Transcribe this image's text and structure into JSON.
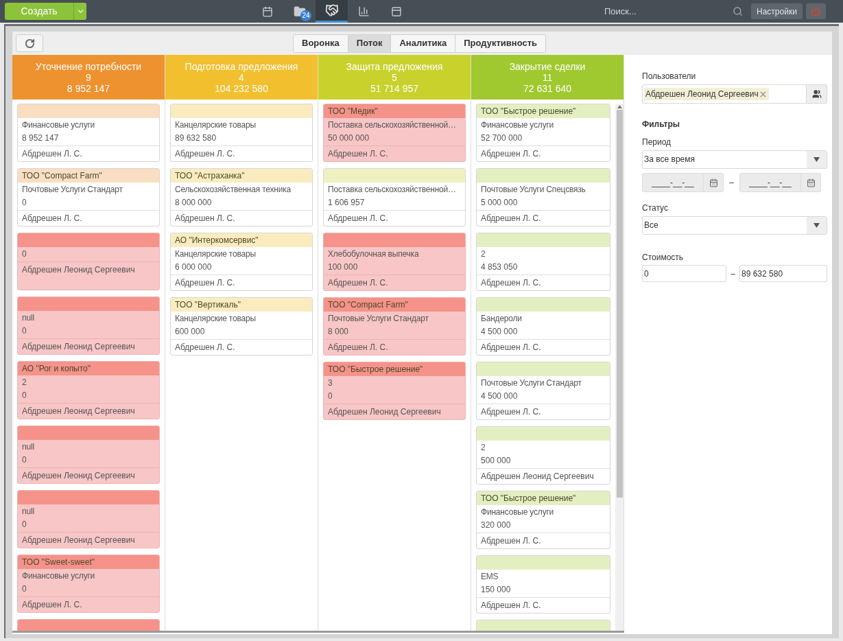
{
  "topbar": {
    "create_button": "Создать",
    "nav_items": [
      {
        "kind": "calendar",
        "selected": false
      },
      {
        "kind": "folder",
        "badge": "24",
        "selected": false
      },
      {
        "kind": "handshake",
        "selected": true
      },
      {
        "kind": "chart",
        "selected": false
      },
      {
        "kind": "window",
        "selected": false
      }
    ],
    "search": {
      "placeholder": "Поиск..."
    },
    "settings_button": "Настройки"
  },
  "tabs": [
    {
      "label": "Воронка",
      "selected": false
    },
    {
      "label": "Поток",
      "selected": true
    },
    {
      "label": "Аналитика",
      "selected": false
    },
    {
      "label": "Продуктивность",
      "selected": false
    }
  ],
  "columns": [
    {
      "title": "Уточнение потребности",
      "count": "9",
      "total": "8 952 147",
      "color": "#ee9230",
      "cards": [
        {
          "kind": "normal",
          "product": "Финансовые услуги",
          "amount": "8 952 147",
          "author": "Абдрешен Л. С."
        },
        {
          "kind": "normal",
          "company": "ТОО \"Compact Farm\"",
          "product": "Почтовые Услуги Стандарт",
          "amount": "0",
          "author": "Абдрешен Л. С."
        },
        {
          "kind": "overdue",
          "amount": "0",
          "author": "Абдрешен Леонид Сергеевич"
        },
        {
          "kind": "overdue",
          "product": "null",
          "amount": "0",
          "author": "Абдрешен Леонид Сергеевич"
        },
        {
          "kind": "overdue",
          "company": "АО \"Рог и копыто\"",
          "product": "2",
          "amount": "0",
          "author": "Абдрешен Леонид Сергеевич"
        },
        {
          "kind": "overdue",
          "product": "null",
          "amount": "0",
          "author": "Абдрешен Леонид Сергеевич"
        },
        {
          "kind": "overdue",
          "product": "null",
          "amount": "0",
          "author": "Абдрешен Леонид Сергеевич"
        },
        {
          "kind": "overdue",
          "company": "ТОО \"Sweet-sweet\"",
          "product": "Финансовые услуги",
          "amount": "0",
          "author": "Абдрешен Л. С."
        },
        {
          "kind": "overdue"
        }
      ]
    },
    {
      "title": "Подготовка предложения",
      "count": "4",
      "total": "104 232 580",
      "color": "#f2bf2e",
      "cards": [
        {
          "kind": "normal",
          "product": "Канцелярские товары",
          "amount": "89 632 580",
          "author": "Абдрешен Л. С."
        },
        {
          "kind": "normal",
          "company": "ТОО \"Астраханка\"",
          "product": "Сельскохозяйственная техника",
          "amount": "8 000 000",
          "author": "Абдрешен Л. С."
        },
        {
          "kind": "normal",
          "company": "АО \"Интеркомсервис\"",
          "product": "Канцелярские товары",
          "amount": "6 000 000",
          "author": "Абдрешен Л. С."
        },
        {
          "kind": "normal",
          "company": "ТОО \"Вертикаль\"",
          "product": "Канцелярские товары",
          "amount": "600 000",
          "author": "Абдрешен Л. С."
        }
      ]
    },
    {
      "title": "Защита предложения",
      "count": "5",
      "total": "51 714 957",
      "color": "#c9d22d",
      "cards": [
        {
          "kind": "overdue",
          "company": "ТОО \"Медик\"",
          "product": "Поставка сельскохозяйственной…",
          "amount": "50 000 000",
          "author": "Абдрешен Л. С."
        },
        {
          "kind": "normal",
          "product": "Поставка сельскохозяйственной…",
          "amount": "1 606 957",
          "author": "Абдрешен Л. С."
        },
        {
          "kind": "overdue",
          "product": "Хлебобулочная выпечка",
          "amount": "100 000",
          "author": "Абдрешен Л. С."
        },
        {
          "kind": "overdue",
          "company": "ТОО \"Compact Farm\"",
          "product": "Почтовые Услуги Стандарт",
          "amount": "8 000",
          "author": "Абдрешен Л. С."
        },
        {
          "kind": "overdue",
          "company": "ТОО \"Быстрое решение\"",
          "product": "3",
          "amount": "0",
          "author": "Абдрешен Леонид Сергеевич"
        }
      ]
    },
    {
      "title": "Закрытие сделки",
      "count": "11",
      "total": "72 631 640",
      "color": "#a0c92f",
      "cards": [
        {
          "kind": "normal",
          "company": "ТОО \"Быстрое решение\"",
          "product": "Финансовые услуги",
          "amount": "52 700 000",
          "author": "Абдрешен Л. С."
        },
        {
          "kind": "normal",
          "product": "Почтовые Услуги Спецсвязь",
          "amount": "5 000 000",
          "author": "Абдрешен Л. С."
        },
        {
          "kind": "normal",
          "product": "2",
          "amount": "4 853 050",
          "author": "Абдрешен Л. С."
        },
        {
          "kind": "normal",
          "product": "Бандероли",
          "amount": "4 500 000",
          "author": "Абдрешен Л. С."
        },
        {
          "kind": "normal",
          "product": "Почтовые Услуги Стандарт",
          "amount": "4 500 000",
          "author": "Абдрешен Л. С."
        },
        {
          "kind": "normal",
          "product": "2",
          "amount": "500 000",
          "author": "Абдрешен Леонид Сергеевич"
        },
        {
          "kind": "normal",
          "company": "ТОО \"Быстрое решение\"",
          "product": "Финансовые услуги",
          "amount": "320 000",
          "author": "Абдрешен Л. С."
        },
        {
          "kind": "normal",
          "product": "EMS",
          "amount": "150 000",
          "author": "Абдрешен Л. С."
        },
        {
          "kind": "normal"
        }
      ]
    }
  ],
  "filters": {
    "users_label": "Пользователи",
    "user_chip": "Абдрешен Леонид Сергеевич",
    "heading": "Фильтры",
    "period_label": "Период",
    "period_value": "За все время",
    "date_from": {
      "placeholder": "____-__-__"
    },
    "date_dash": "–",
    "date_to": {
      "placeholder": "____-__-__"
    },
    "status_label": "Статус",
    "status_value": "Все",
    "cost_label": "Стоимость",
    "cost_from": "0",
    "cost_dash": "–",
    "cost_to": "89 632 580"
  }
}
